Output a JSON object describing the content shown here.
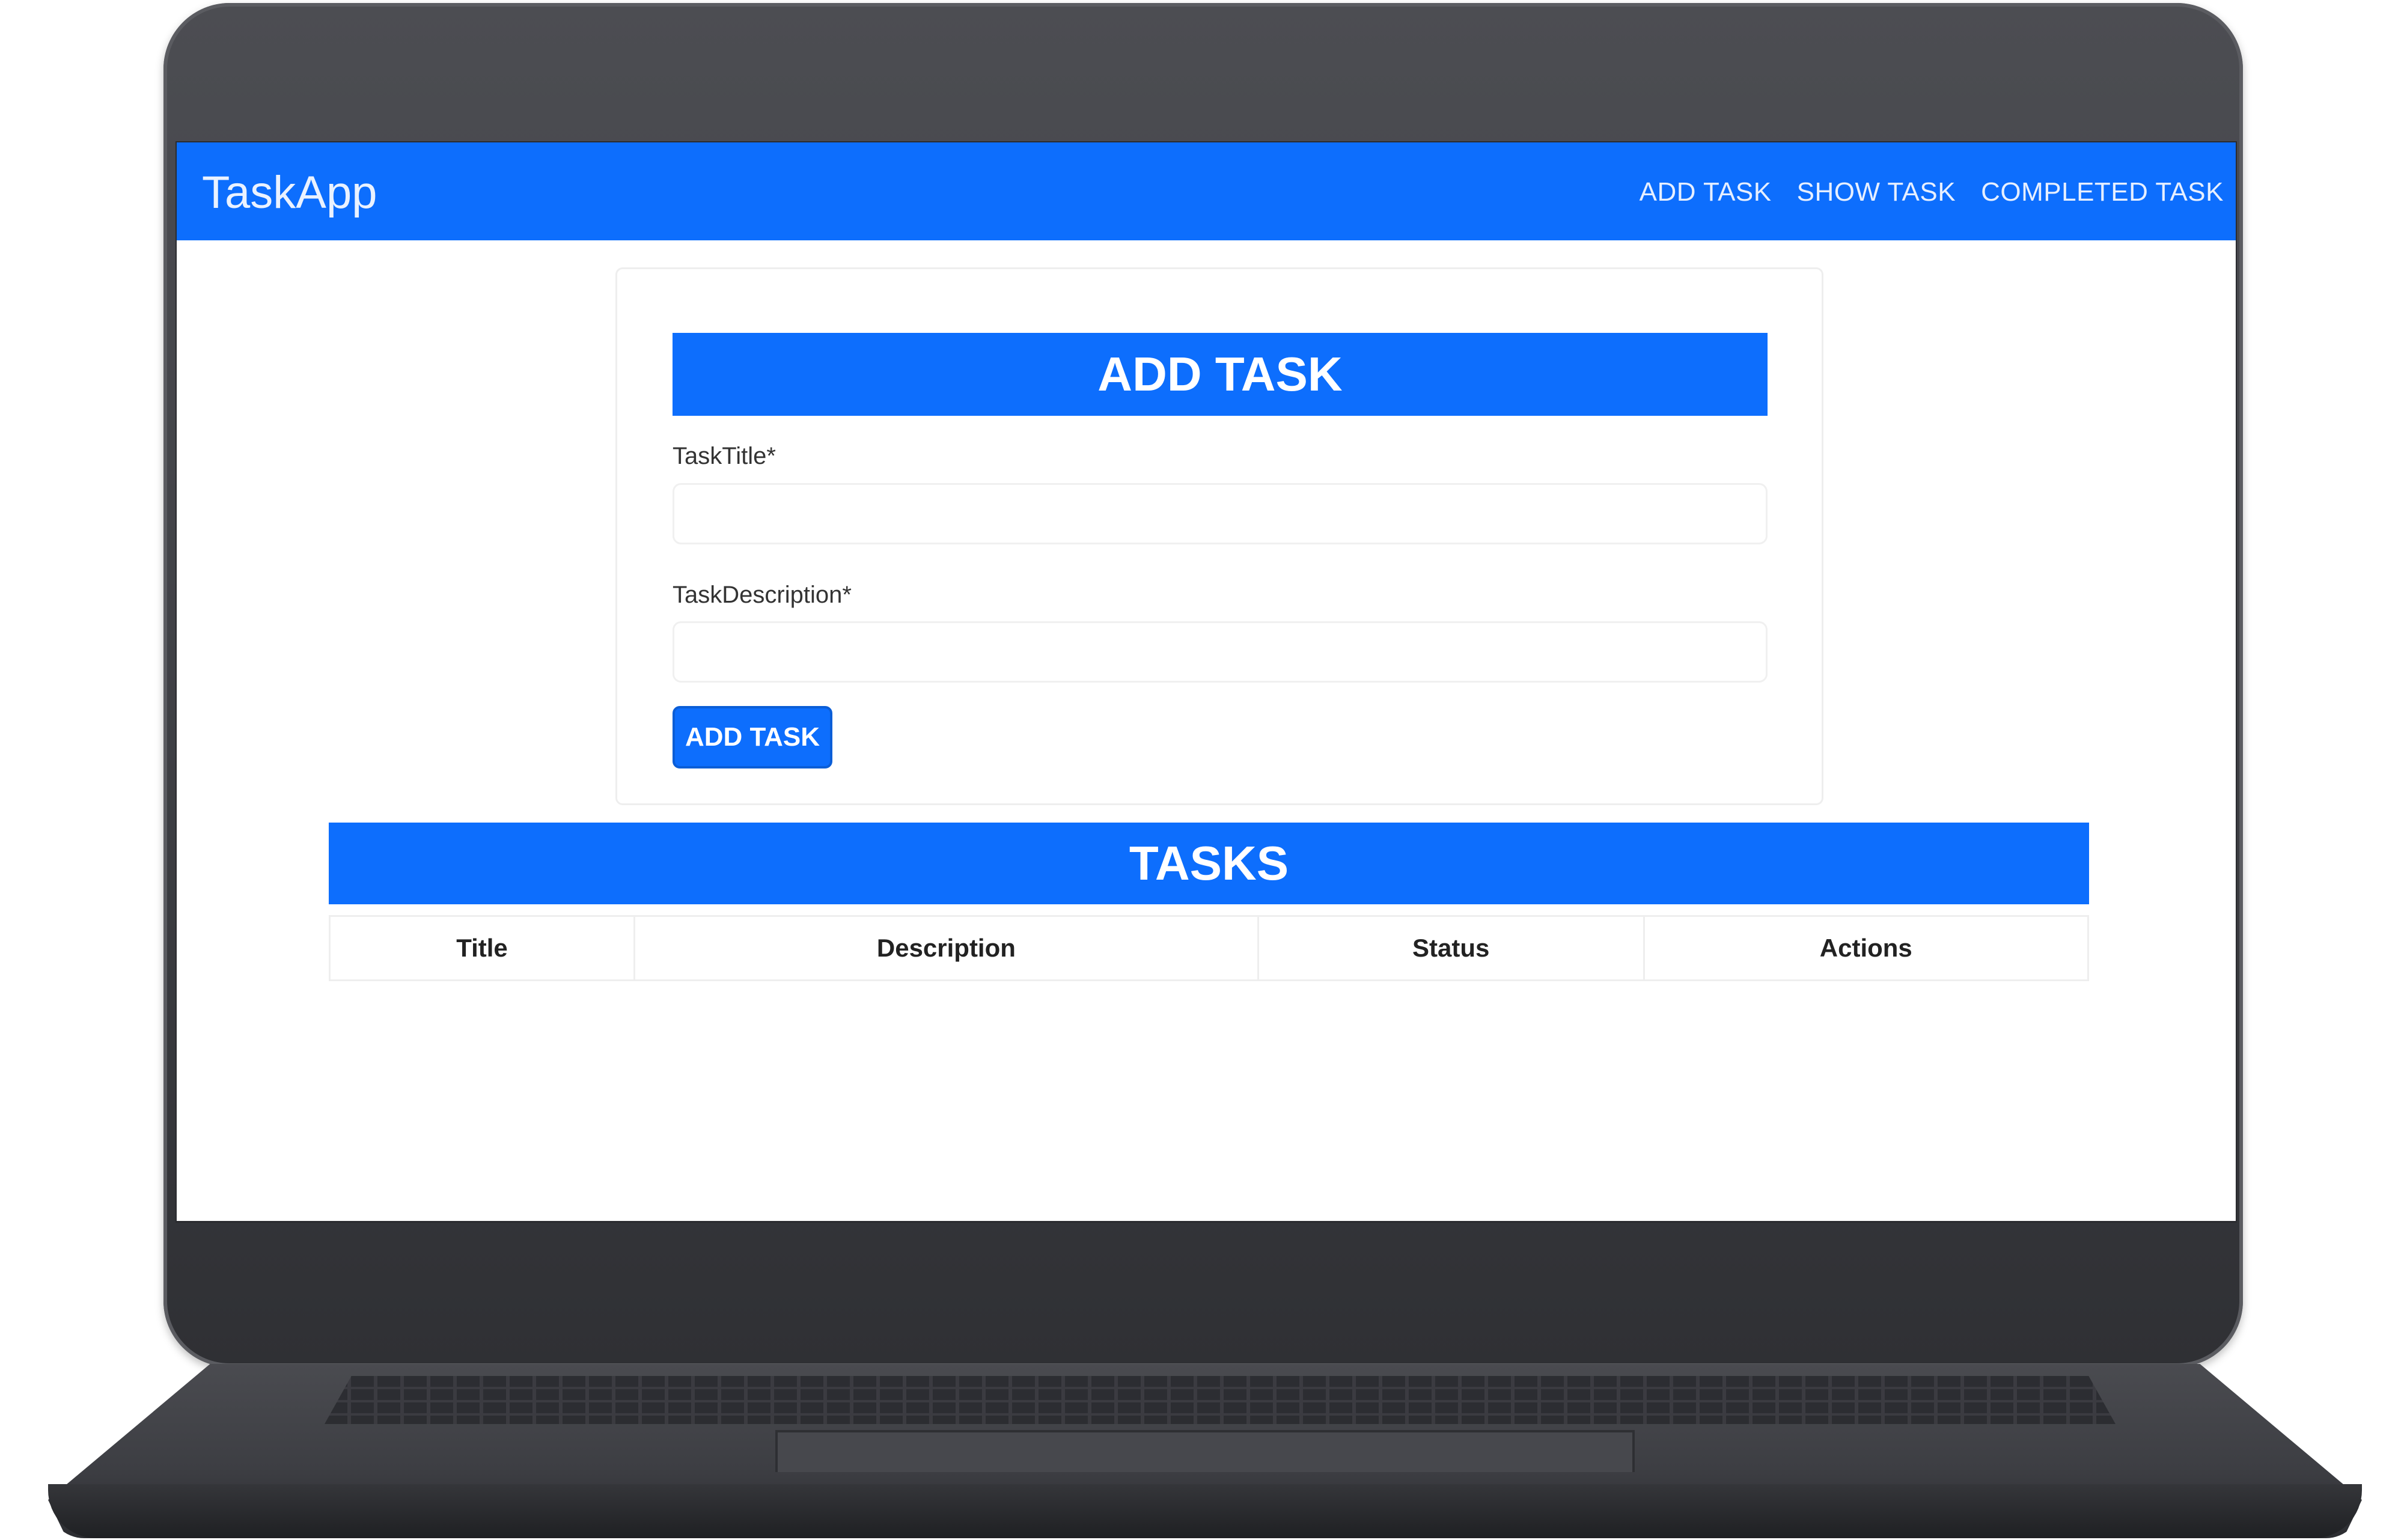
{
  "app": {
    "brand": "TaskApp",
    "nav": [
      "ADD TASK",
      "SHOW TASK",
      "COMPLETED TASK"
    ]
  },
  "form": {
    "header": "ADD TASK",
    "title_label": "TaskTitle*",
    "title_value": "",
    "description_label": "TaskDescription*",
    "description_value": "",
    "submit_label": "ADD TASK"
  },
  "tasks": {
    "header": "TASKS",
    "columns": [
      "Title",
      "Description",
      "Status",
      "Actions"
    ],
    "rows": []
  },
  "colors": {
    "primary": "#0d6efd",
    "laptop_frame": "#414247"
  }
}
